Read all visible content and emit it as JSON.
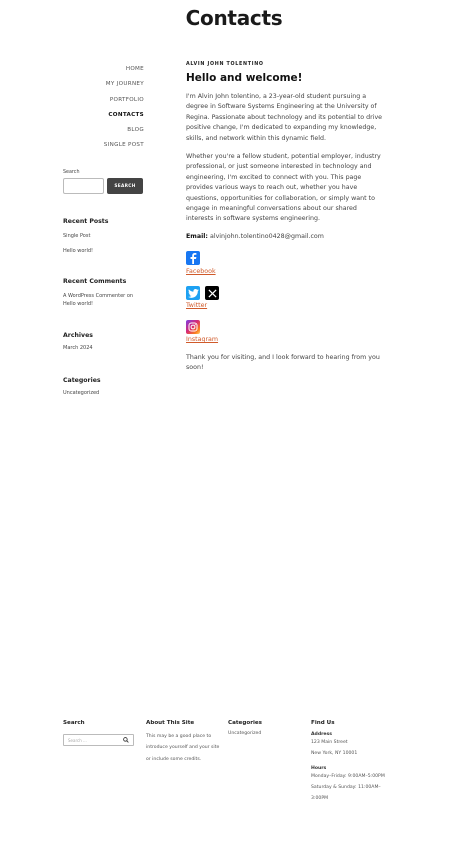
{
  "page": {
    "title": "Contacts"
  },
  "nav": {
    "items": [
      {
        "label": "HOME",
        "current": false
      },
      {
        "label": "MY JOURNEY",
        "current": false
      },
      {
        "label": "PORTFOLIO",
        "current": false
      },
      {
        "label": "CONTACTS",
        "current": true
      },
      {
        "label": "BLOG",
        "current": false
      },
      {
        "label": "SINGLE POST",
        "current": false
      }
    ]
  },
  "sidebar": {
    "search_label": "Search",
    "search_button": "SEARCH",
    "recent_posts": {
      "title": "Recent Posts",
      "items": [
        "Single Post",
        "Hello world!"
      ]
    },
    "recent_comments": {
      "title": "Recent Comments",
      "line1": "A WordPress Commenter on",
      "line2": "Hello world!"
    },
    "archives": {
      "title": "Archives",
      "items": [
        "March 2024"
      ]
    },
    "categories": {
      "title": "Categories",
      "items": [
        "Uncategorized"
      ]
    }
  },
  "main": {
    "author": "ALVIN JOHN TOLENTINO",
    "heading": "Hello and welcome!",
    "para1": "I'm Alvin John tolentino, a 23-year-old student pursuing a degree in Software Systems Engineering at the University of Regina. Passionate about technology and its potential to drive positive change, I'm dedicated to expanding my knowledge, skills, and network within this dynamic field.",
    "para2": "Whether you're a fellow student, potential employer, industry professional, or just someone interested in technology and engineering, I'm excited to connect with you. This page provides various ways to reach out, whether you have questions, opportunities for collaboration, or simply want to engage in meaningful conversations about our shared interests in software systems engineering.",
    "email_label": "Email:",
    "email_value": "alvinjohn.tolentino0428@gmail.com",
    "facebook": "Facebook",
    "twitter": "Twitter",
    "instagram": "Instagram",
    "closing": "Thank you for visiting, and I look forward to hearing from you soon!"
  },
  "footer": {
    "search": {
      "title": "Search",
      "placeholder": "Search ..."
    },
    "about": {
      "title": "About This Site",
      "text": "This may be a good place to introduce yourself and your site or include some credits."
    },
    "categories": {
      "title": "Categories",
      "item": "Uncategorized"
    },
    "find_us": {
      "title": "Find Us",
      "address_label": "Address",
      "address1": "123 Main Street",
      "address2": "New York, NY 10001",
      "hours_label": "Hours",
      "hours1": "Monday–Friday: 9:00AM–5:00PM",
      "hours2": "Saturday & Sunday: 11:00AM–3:00PM"
    }
  },
  "colors": {
    "link": "#d05a2a",
    "button": "#444444",
    "facebook": "#1877f2",
    "twitter": "#1da1f2"
  }
}
